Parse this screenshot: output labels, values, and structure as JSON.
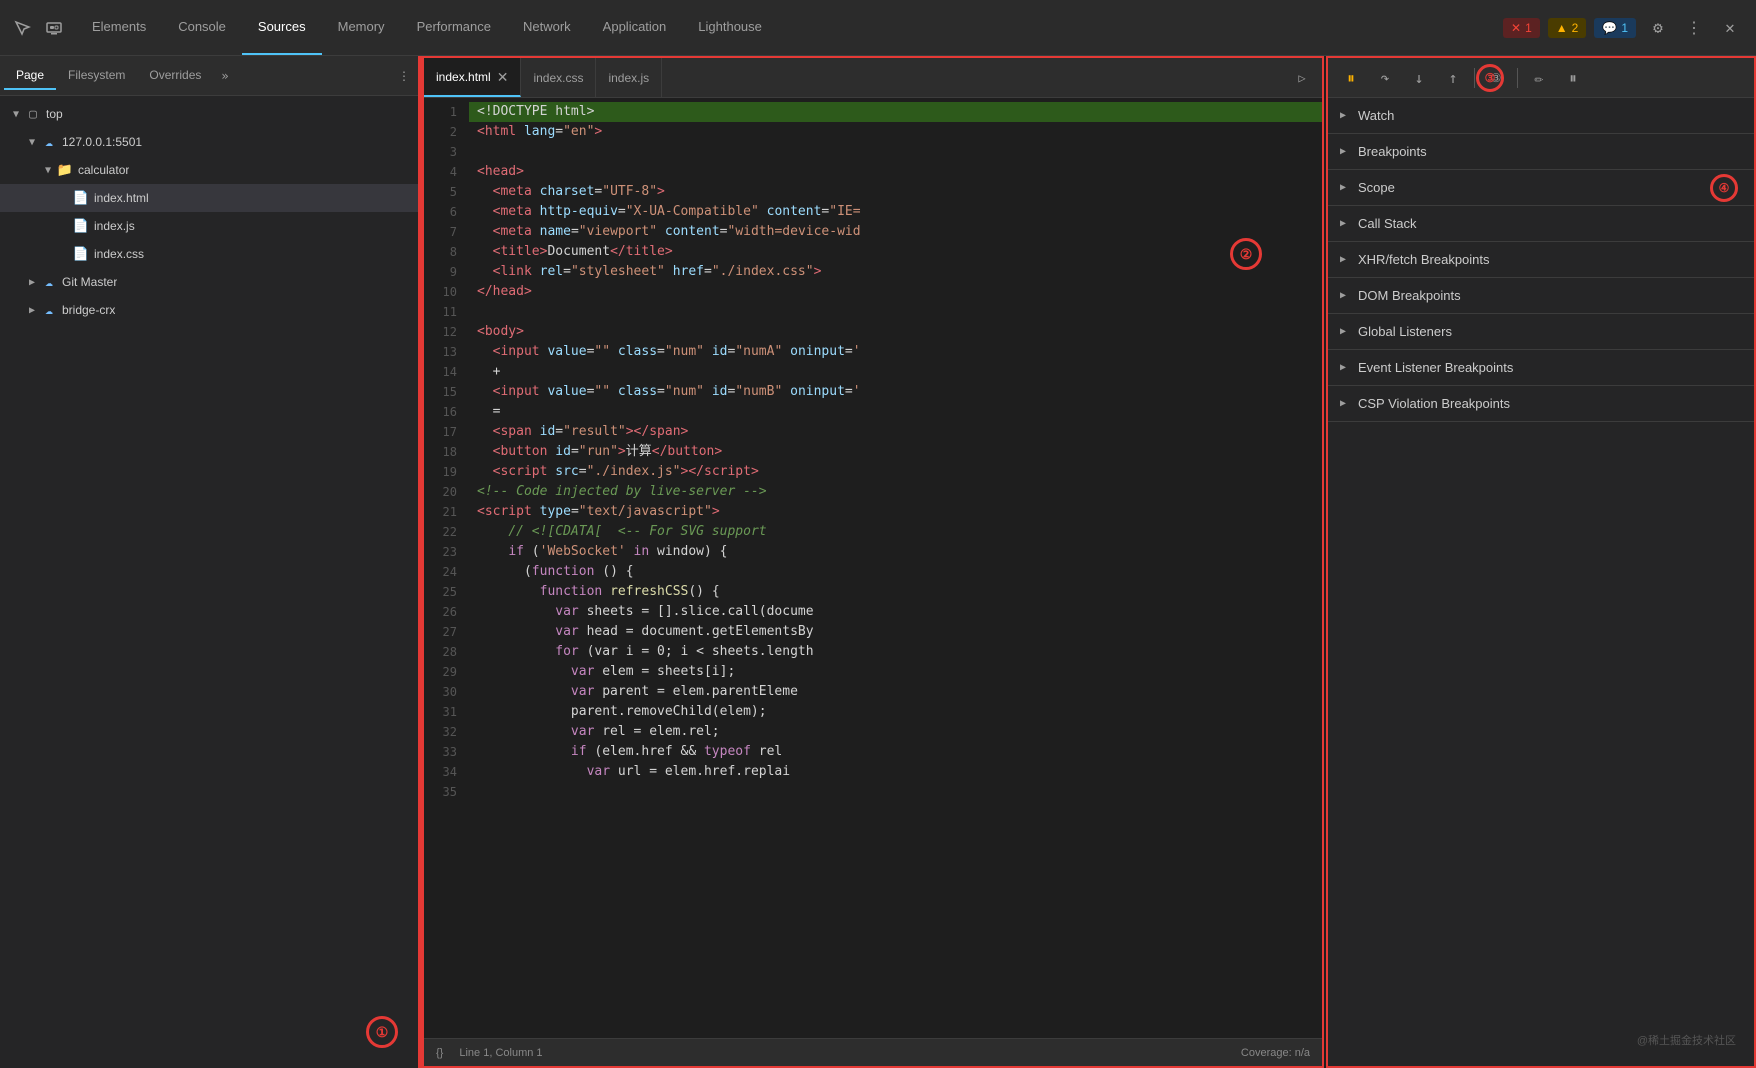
{
  "topbar": {
    "tabs": [
      {
        "id": "elements",
        "label": "Elements",
        "active": false
      },
      {
        "id": "console",
        "label": "Console",
        "active": false
      },
      {
        "id": "sources",
        "label": "Sources",
        "active": true
      },
      {
        "id": "memory",
        "label": "Memory",
        "active": false
      },
      {
        "id": "performance",
        "label": "Performance",
        "active": false
      },
      {
        "id": "network",
        "label": "Network",
        "active": false
      },
      {
        "id": "application",
        "label": "Application",
        "active": false
      },
      {
        "id": "lighthouse",
        "label": "Lighthouse",
        "active": false
      }
    ],
    "badges": {
      "errors": "1",
      "warnings": "2",
      "info": "1"
    }
  },
  "left_panel": {
    "tabs": [
      {
        "label": "Page",
        "active": true
      },
      {
        "label": "Filesystem",
        "active": false
      },
      {
        "label": "Overrides",
        "active": false
      }
    ],
    "tree": {
      "top": "top",
      "server": "127.0.0.1:5501",
      "calculator": "calculator",
      "files": [
        {
          "name": "index.html",
          "type": "html",
          "selected": true
        },
        {
          "name": "index.js",
          "type": "js"
        },
        {
          "name": "index.css",
          "type": "css"
        }
      ],
      "other": [
        {
          "name": "Git Master",
          "type": "cloud"
        },
        {
          "name": "bridge-crx",
          "type": "cloud"
        }
      ]
    }
  },
  "editor": {
    "tabs": [
      {
        "label": "index.html",
        "active": true
      },
      {
        "label": "index.css",
        "active": false
      },
      {
        "label": "index.js",
        "active": false
      }
    ],
    "status": {
      "left": "Line 1, Column 1",
      "right": "Coverage: n/a"
    }
  },
  "right_panel": {
    "sections": [
      {
        "label": "Watch"
      },
      {
        "label": "Breakpoints"
      },
      {
        "label": "Scope"
      },
      {
        "label": "Call Stack"
      },
      {
        "label": "XHR/fetch Breakpoints"
      },
      {
        "label": "DOM Breakpoints"
      },
      {
        "label": "Global Listeners"
      },
      {
        "label": "Event Listener Breakpoints"
      },
      {
        "label": "CSP Violation Breakpoints"
      }
    ]
  },
  "watermark": "@稀土掘金技术社区",
  "annotations": {
    "one": "①",
    "two": "②",
    "three": "③",
    "four": "④"
  }
}
